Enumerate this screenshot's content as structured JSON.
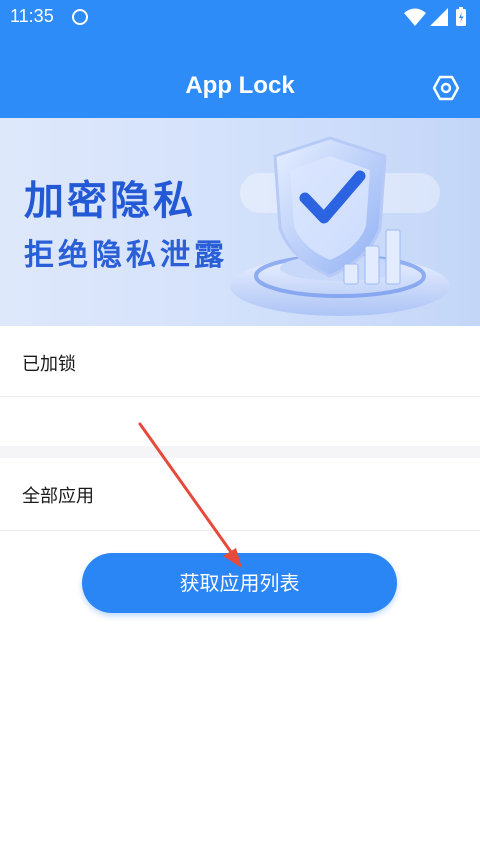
{
  "status_bar": {
    "time": "11:35"
  },
  "app_bar": {
    "title": "App Lock"
  },
  "banner": {
    "headline": "加密隐私",
    "subheadline": "拒绝隐私泄露"
  },
  "sections": {
    "locked_label": "已加锁",
    "all_apps_label": "全部应用"
  },
  "actions": {
    "fetch_button_label": "获取应用列表"
  },
  "colors": {
    "primary": "#2d8cf8",
    "button": "#2a85f5",
    "arrow": "#e64a3b",
    "banner_text": "#2459d6"
  },
  "icons": {
    "settings": "hexagon-gear-icon",
    "wifi": "wifi-icon",
    "signal": "signal-icon",
    "battery": "battery-icon",
    "status": "circle-icon"
  }
}
